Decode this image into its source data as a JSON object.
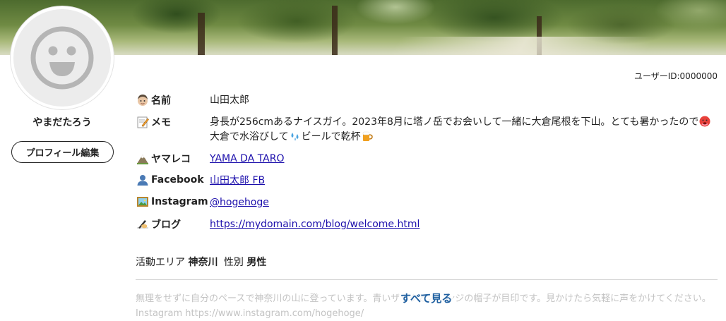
{
  "profile": {
    "display_name": "やまだたろう",
    "edit_button": "プロフィール編集",
    "user_id": "ユーザーID:0000000"
  },
  "fields": {
    "name_label": "名前",
    "name_value": "山田太郎",
    "memo_label": "メモ",
    "memo_line1": "身長が256cmあるナイスガイ。2023年8月に塔ノ岳でお会いして一緒に大倉尾根を下山。とても暑かったので",
    "memo_line2a": "大倉で水浴びして",
    "memo_line2b": "ビールで乾杯",
    "yamareco_label": "ヤマレコ",
    "yamareco_value": "YAMA DA TARO",
    "facebook_label": "Facebook",
    "facebook_value": "山田太郎 FB",
    "instagram_label": "Instagram",
    "instagram_value": "@hogehoge",
    "blog_label": "ブログ",
    "blog_value": "https://mydomain.com/blog/welcome.html"
  },
  "meta": {
    "area_label": "活動エリア",
    "area_value": "神奈川",
    "gender_label": "性別",
    "gender_value": "男性"
  },
  "bio": {
    "line1": "無理をせずに自分のペースで神奈川の山に登っています。青いザックとオレンジの帽子が目印です。見かけたら気軽に声をかけてください。",
    "line2": "Instagram https://www.instagram.com/hogehoge/",
    "see_all": "すべて見る"
  },
  "icons": {
    "avatar": "smiley-face-icon",
    "name": "man-face-emoji",
    "memo": "memo-emoji",
    "yamareco": "mountain-tent-emoji",
    "facebook": "bust-silhouette-emoji",
    "instagram": "framed-picture-emoji",
    "blog": "writing-hand-emoji",
    "hot": "hot-face-emoji",
    "water": "sweat-droplets-emoji",
    "beer": "beer-mug-emoji"
  },
  "colors": {
    "link": "#1a0dab",
    "see_all": "#1e5fa0",
    "avatar_bg": "#ececec",
    "avatar_face": "#b5b5b5"
  }
}
